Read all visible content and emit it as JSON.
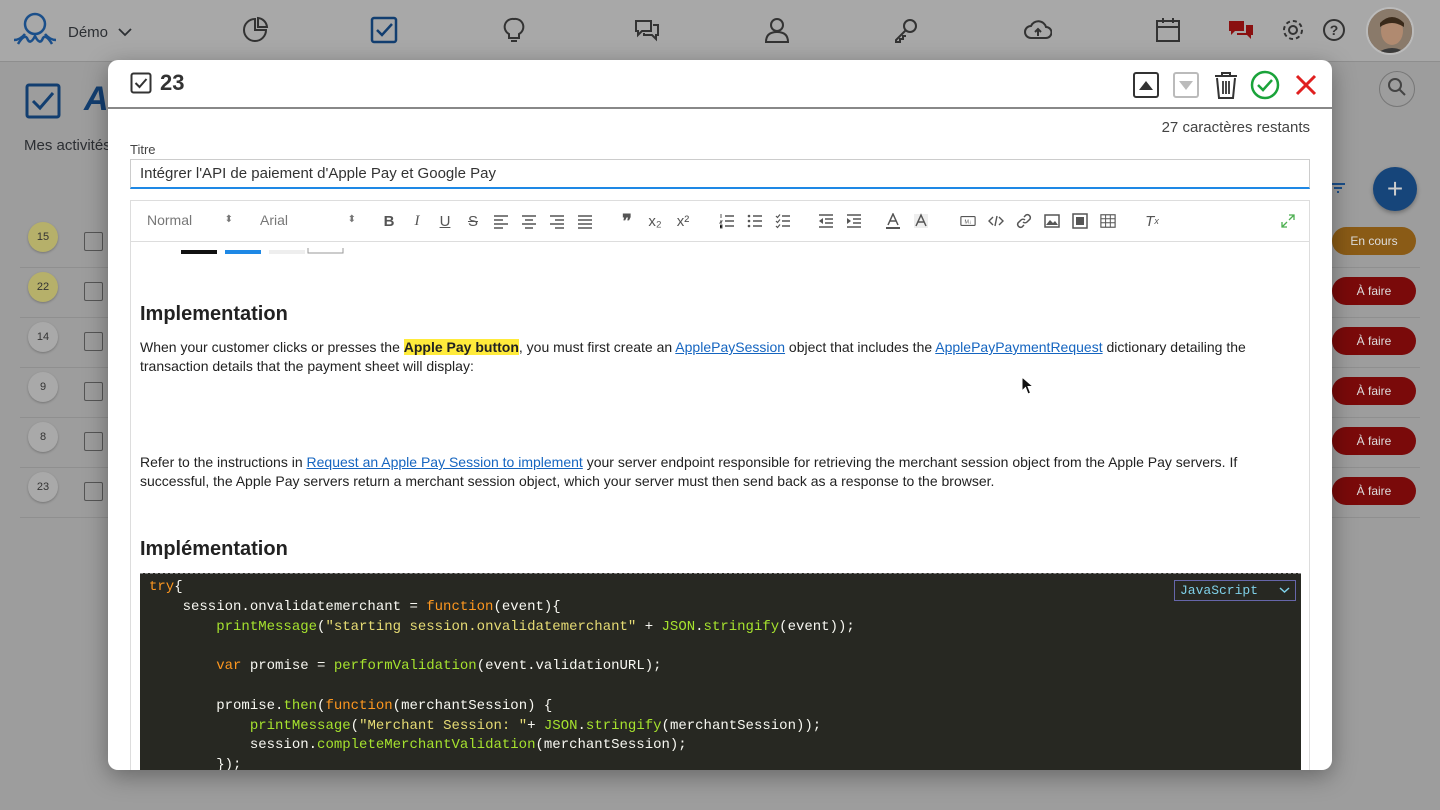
{
  "app": {
    "brand_name": "Démo",
    "page_subtitle": "Mes activités",
    "page_title_initial": "A",
    "colors": {
      "accent": "#1e88e5",
      "brand": "#1565c0",
      "todo": "#c62828",
      "in_progress": "#e68a00"
    }
  },
  "nav": {
    "icons": [
      "octopus-logo-icon",
      "chevron-down-icon",
      "pie-chart-icon",
      "checkbox-icon",
      "lightbulb-icon",
      "chat-icon",
      "user-icon",
      "key-icon",
      "cloud-upload-icon",
      "calendar-icon",
      "messages-icon",
      "gear-icon",
      "help-icon"
    ]
  },
  "background_rows": [
    {
      "num": "15",
      "status": "En cours"
    },
    {
      "num": "22",
      "status": "À faire"
    },
    {
      "num": "14",
      "status": "À faire"
    },
    {
      "num": "9",
      "status": "À faire"
    },
    {
      "num": "8",
      "status": "À faire"
    },
    {
      "num": "23",
      "status": "À faire"
    }
  ],
  "modal": {
    "task_number": "23",
    "remaining_chars": "27 caractères restants",
    "title_label": "Titre",
    "title_value": "Intégrer l'API de paiement d'Apple Pay et Google Pay"
  },
  "toolbar": {
    "format_select": "Normal",
    "font_select": "Arial"
  },
  "content": {
    "heading1": "Implementation",
    "para1": {
      "pre": "When your customer clicks or presses the ",
      "highlight": "Apple Pay button",
      "mid1": ", you must first create an ",
      "link1": "ApplePaySession",
      "mid2": " object that includes the ",
      "link2": "ApplePayPaymentRequest",
      "post": "  dictionary detailing the transaction details that the payment sheet will display:"
    },
    "para2": {
      "pre": "Refer to the instructions in ",
      "link": "Request an Apple Pay Session to implement",
      "post": " your server endpoint responsible for retrieving the merchant session object from the Apple Pay servers. If successful, the Apple Pay servers return a merchant session object, which your server must then send back as a response to the browser."
    },
    "heading2": "Implémentation",
    "code_language": "JavaScript",
    "code": {
      "l1_kw": "try",
      "l1_rest": "{",
      "l2_a": "    session.onvalidatemerchant = ",
      "l2_kw": "function",
      "l2_b": "(event){",
      "l3_fn": "printMessage",
      "l3_a": "(",
      "l3_str": "\"starting session.onvalidatemerchant\"",
      "l3_b": " + ",
      "l3_fn2": "JSON",
      "l3_c": ".",
      "l3_fn3": "stringify",
      "l3_d": "(event));",
      "l5_kw": "var",
      "l5_a": " promise = ",
      "l5_fn": "performValidation",
      "l5_b": "(event.validationURL);",
      "l7_a": "promise.",
      "l7_fn": "then",
      "l7_b": "(",
      "l7_kw": "function",
      "l7_c": "(merchantSession) {",
      "l8_fn": "printMessage",
      "l8_a": "(",
      "l8_str": "\"Merchant Session: \"",
      "l8_b": "+ ",
      "l8_fn2": "JSON",
      "l8_c": ".",
      "l8_fn3": "stringify",
      "l8_d": "(merchantSession));",
      "l9_a": "session.",
      "l9_fn": "completeMerchantValidation",
      "l9_b": "(merchantSession);",
      "l10": "});"
    }
  }
}
